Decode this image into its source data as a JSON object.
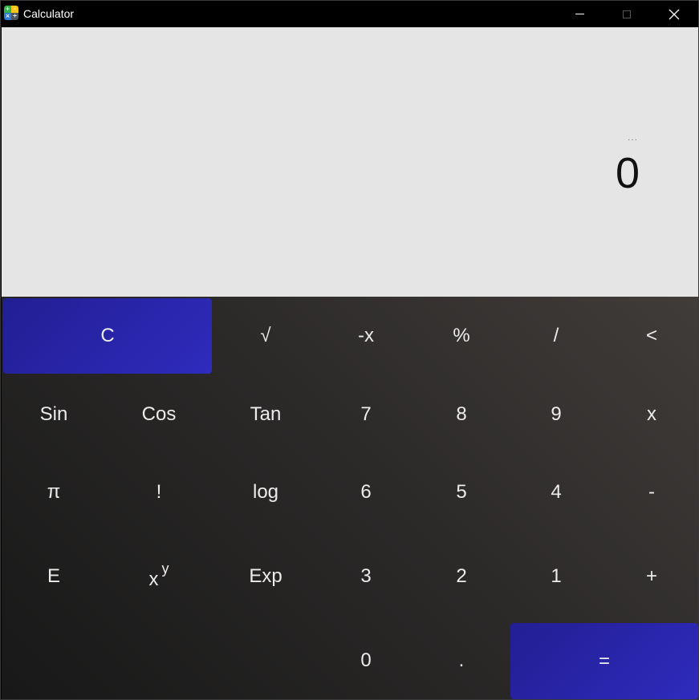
{
  "window": {
    "title": "Calculator"
  },
  "display": {
    "expression": "...",
    "value": "0"
  },
  "keys": {
    "clear": "C",
    "sqrt": "√",
    "negate": "-x",
    "percent": "%",
    "divide": "/",
    "backspace": "<",
    "sin": "Sin",
    "cos": "Cos",
    "tan": "Tan",
    "seven": "7",
    "eight": "8",
    "nine": "9",
    "multiply": "x",
    "pi": "π",
    "factorial": "!",
    "log": "log",
    "six": "6",
    "five": "5",
    "four": "4",
    "minus": "-",
    "e": "E",
    "power_base": "x",
    "power_exp": "y",
    "exp": "Exp",
    "three": "3",
    "two": "2",
    "one": "1",
    "plus": "+",
    "zero": "0",
    "decimal": ".",
    "equals": "="
  },
  "colors": {
    "accent": "#2a27b0",
    "display_bg": "#e5e5e5",
    "keypad_bg": "#2c2a29"
  }
}
